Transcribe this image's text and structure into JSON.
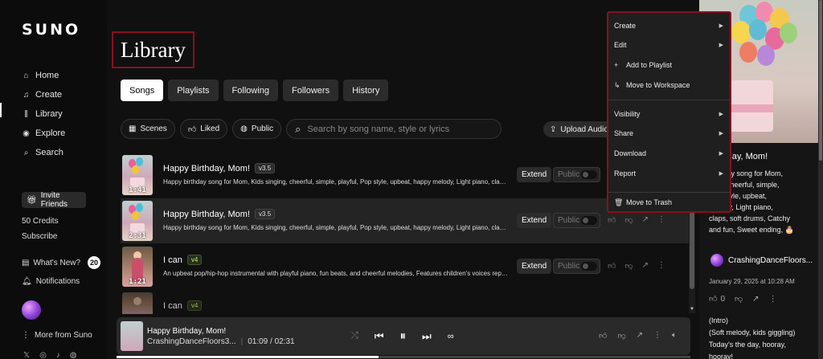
{
  "sidebar": {
    "logo": "SUNO",
    "nav": [
      {
        "label": "Home",
        "icon": "home-icon"
      },
      {
        "label": "Create",
        "icon": "music-note-icon"
      },
      {
        "label": "Library",
        "icon": "library-icon"
      },
      {
        "label": "Explore",
        "icon": "compass-icon"
      },
      {
        "label": "Search",
        "icon": "search-icon"
      }
    ],
    "invite_label": "Invite Friends",
    "credits": "50 Credits",
    "subscribe": "Subscribe",
    "whats_new": "What's New?",
    "whats_new_count": "20",
    "notifications": "Notifications",
    "more": "More from Suno"
  },
  "main": {
    "title": "Library",
    "tabs": [
      "Songs",
      "Playlists",
      "Following",
      "Followers",
      "History"
    ],
    "active_tab": "Songs",
    "filters": {
      "scenes": "Scenes",
      "liked": "Liked",
      "public": "Public"
    },
    "search_placeholder": "Search by song name, style or lyrics",
    "upload": "Upload Audio",
    "extend_label": "Extend",
    "public_label": "Public",
    "songs": [
      {
        "title": "Happy Birthday, Mom!",
        "version": "v3.5",
        "duration": "1:41",
        "desc": "Happy birthday song for Mom, Kids singing, cheerful, simple, playful, Pop style, upbeat, happy melody, Light piano, claps, soft ..."
      },
      {
        "title": "Happy Birthday, Mom!",
        "version": "v3.5",
        "duration": "2:31",
        "desc": "Happy birthday song for Mom, Kids singing, cheerful, simple, playful, Pop style, upbeat, happy melody, Light piano, claps, soft ..."
      },
      {
        "title": "I can",
        "version": "v4",
        "duration": "1:21",
        "desc": "An upbeat pop/hip-hop instrumental with playful piano, fun beats, and cheerful melodies, Features children's voices repeatin..."
      },
      {
        "title": "I can",
        "version": "v4",
        "duration": "",
        "desc": ""
      }
    ]
  },
  "player": {
    "title": "Happy Birthday, Mom!",
    "artist": "CrashingDanceFloors3...",
    "time": "01:09 / 02:31",
    "progress": 0.457
  },
  "menu": {
    "items": [
      {
        "label": "Create",
        "submenu": true
      },
      {
        "label": "Edit",
        "submenu": true
      },
      {
        "label": "Add to Playlist",
        "icon": "plus-icon"
      },
      {
        "label": "Move to Workspace",
        "icon": "move-icon"
      },
      {
        "label": "Visibility",
        "submenu": true
      },
      {
        "label": "Share",
        "submenu": true
      },
      {
        "label": "Download",
        "submenu": true
      },
      {
        "label": "Report",
        "submenu": true
      },
      {
        "label": "Move to Trash",
        "icon": "trash-icon"
      }
    ]
  },
  "right_panel": {
    "title": "Birthday, Mom!",
    "desc": "birthday song for Mom, ... ging, cheerful, simple, Pop style, upbeat, melody, Light piano, claps, soft drums, Catchy and fun, Sweet ending, 🎂",
    "desc_lines": [
      "birthday song for Mom,",
      "ging, cheerful, simple,",
      "Pop style, upbeat,",
      "melody, Light piano,",
      "claps, soft drums, Catchy",
      "and fun, Sweet ending, 🎂"
    ],
    "user": "CrashingDanceFloors...",
    "date": "January 29, 2025 at 10:28 AM",
    "likes": "0",
    "lyrics": [
      "(Intro)",
      "(Soft melody, kids giggling)",
      "Today's the day, hooray,",
      "hooray!"
    ]
  }
}
